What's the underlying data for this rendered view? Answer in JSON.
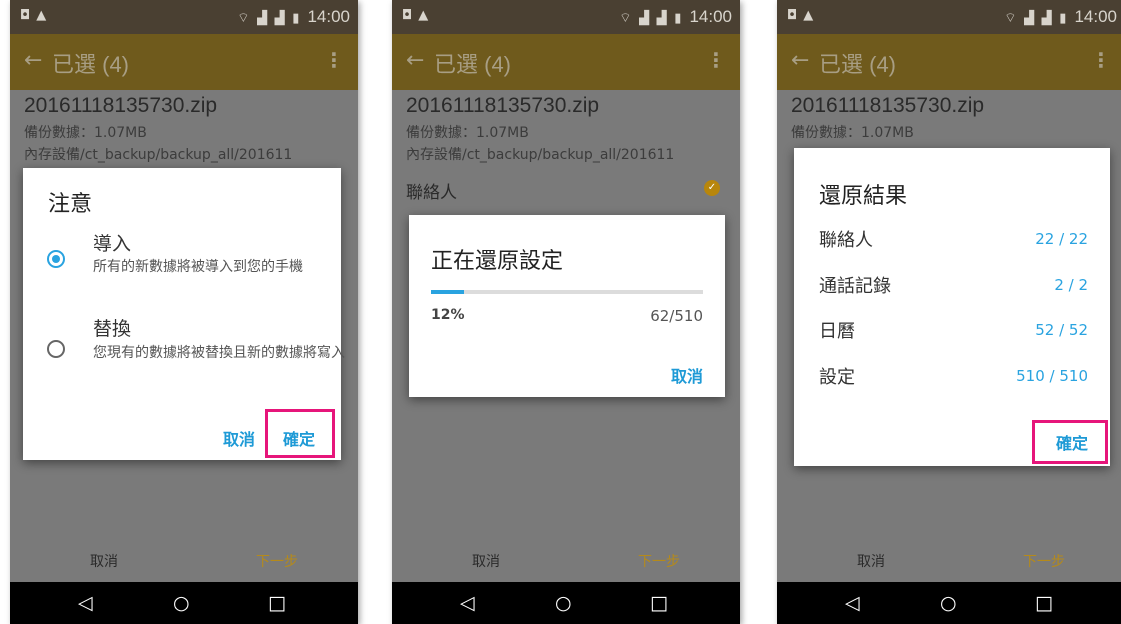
{
  "status": {
    "time": "14:00"
  },
  "appbar": {
    "back_icon": "arrow-left-icon",
    "title": "已選 (4)",
    "menu_icon": "more-vert-icon"
  },
  "file": {
    "name": "20161118135730.zip",
    "info": "備份數據：1.07MB",
    "path": "內存設備/ct_backup/backup_all/201611"
  },
  "bottom": {
    "cancel": "取消",
    "next": "下一步"
  },
  "accent": "#29a3e0",
  "dialog1": {
    "title": "注意",
    "options": [
      {
        "title": "導入",
        "desc": "所有的新數據將被導入到您的手機",
        "selected": true
      },
      {
        "title": "替換",
        "desc": "您現有的數據將被替換且新的數據將寫入",
        "selected": false
      }
    ],
    "cancel": "取消",
    "confirm": "確定"
  },
  "screen2": {
    "contact_label": "聯絡人"
  },
  "dialog2": {
    "title": "正在還原設定",
    "percent_text": "12%",
    "progress": 0.12,
    "count": "62/510",
    "cancel": "取消"
  },
  "dialog3": {
    "title": "還原結果",
    "rows": [
      {
        "label": "聯絡人",
        "value": "22 / 22"
      },
      {
        "label": "通話記錄",
        "value": "2 / 2"
      },
      {
        "label": "日曆",
        "value": "52 / 52"
      },
      {
        "label": "設定",
        "value": "510 / 510"
      }
    ],
    "confirm": "確定"
  }
}
